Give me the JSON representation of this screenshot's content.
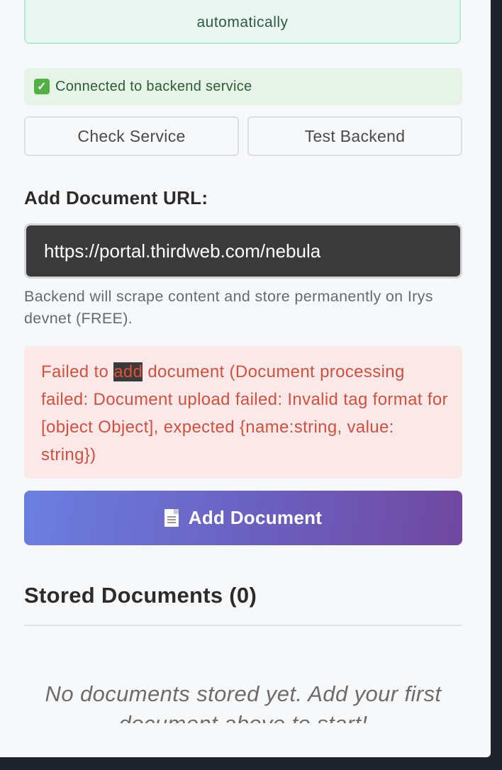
{
  "top_box": {
    "text": "automatically"
  },
  "status": {
    "text": "Connected to backend service",
    "icon": "check-mark-icon"
  },
  "buttons": {
    "check_service": "Check Service",
    "test_backend": "Test Backend"
  },
  "url_section": {
    "label": "Add Document URL:",
    "value": "https://portal.thirdweb.com/nebula",
    "hint": "Backend will scrape content and store permanently on Irys devnet (FREE)."
  },
  "error": {
    "prefix": "Failed to ",
    "highlight": "add",
    "suffix": " document (Document processing failed: Document upload failed: Invalid tag format for [object Object], expected {name:string, value: string})"
  },
  "add_button": {
    "label": "Add Document",
    "icon": "document-icon"
  },
  "stored": {
    "title": "Stored Documents (0)",
    "empty": "No documents stored yet. Add your first document above to start!"
  },
  "colors": {
    "accent_gradient_start": "#6b7fe0",
    "accent_gradient_end": "#7048a0",
    "error_text": "#d2503c",
    "error_bg": "#fbe8e8",
    "success_bg": "#e7f3e8"
  }
}
